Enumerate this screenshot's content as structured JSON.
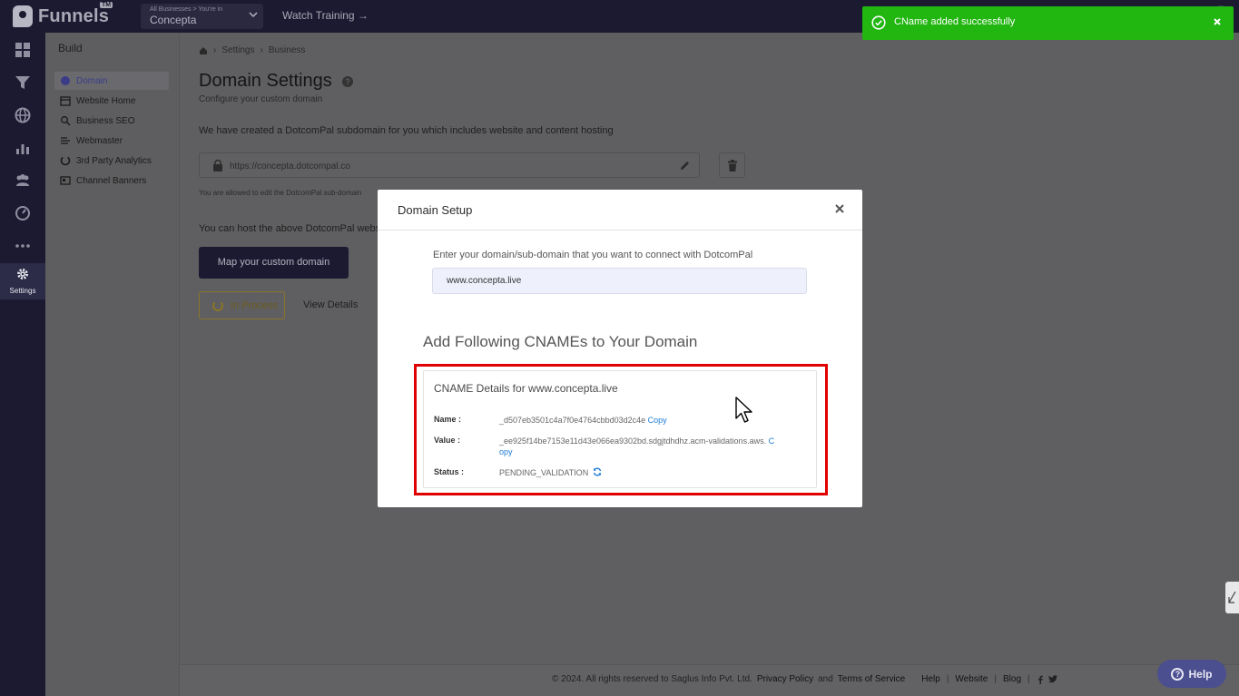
{
  "topbar": {
    "logo_text": "Funnels",
    "logo_tm": "TM",
    "business_hint": "All Businesses > You're in",
    "business_name": "Concepta",
    "watch_training": "Watch Training →"
  },
  "rail": {
    "settings_label": "Settings"
  },
  "build": {
    "title": "Build",
    "items": [
      {
        "label": "Domain",
        "icon": "globe-icon"
      },
      {
        "label": "Website Home",
        "icon": "calendar-icon"
      },
      {
        "label": "Business SEO",
        "icon": "magnify-icon"
      },
      {
        "label": "Webmaster",
        "icon": "webmaster-icon"
      },
      {
        "label": "3rd Party Analytics",
        "icon": "analytics-icon"
      },
      {
        "label": "Channel Banners",
        "icon": "banner-icon"
      }
    ]
  },
  "breadcrumb": [
    "Settings",
    "Business"
  ],
  "page": {
    "title": "Domain Settings",
    "subtitle": "Configure your custom domain",
    "intro": "We have created a DotcomPal subdomain for you which includes website and content hosting",
    "subdomain_url": "https://concepta.dotcompal.co",
    "edit_note": "You are allowed to edit the DotcomPal sub-domain",
    "host_note": "You can host the above DotcomPal website",
    "map_button": "Map your custom domain",
    "status_badge": "In Process",
    "view_details": "View Details"
  },
  "toast": {
    "message": "CName added successfully"
  },
  "modal": {
    "title": "Domain Setup",
    "domain_label": "Enter your domain/sub-domain that you want to connect with DotcomPal",
    "domain_value": "www.concepta.live",
    "heading": "Add Following CNAMEs to Your Domain",
    "card_title": "CNAME Details for www.concepta.live",
    "name_label": "Name :",
    "name_value": "_d507eb3501c4a7f0e4764cbbd03d2c4e",
    "value_label": "Value :",
    "value_value": "_ee925f14be7153e11d43e066ea9302bd.sdgjtdhdhz.acm-validations.aws.",
    "status_label": "Status :",
    "status_value": "PENDING_VALIDATION",
    "copy_label": "Copy"
  },
  "footer": {
    "copyright": "©  2024. All rights reserved to Saglus Info Pvt. Ltd.",
    "privacy": "Privacy Policy",
    "and": "and",
    "terms": "Terms of Service",
    "help": "Help",
    "website": "Website",
    "blog": "Blog"
  },
  "help_button": "Help",
  "colors": {
    "toast_green": "#21b610",
    "highlight_red": "#e00000",
    "link_blue": "#1a7bd6",
    "nav_dark": "#1b1a30",
    "help_purple": "#4b4e8f"
  }
}
